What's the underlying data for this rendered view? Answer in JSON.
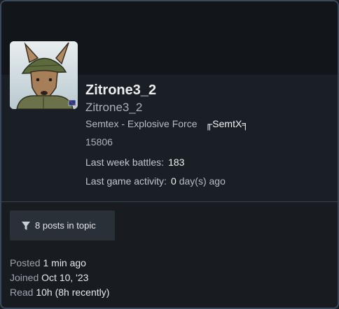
{
  "profile": {
    "username": "Zitrone3_2",
    "handle": "Zitrone3_2",
    "clan_name": "Semtex - Explosive Force",
    "clan_tag": "╓SemtX╕",
    "rating": "15806",
    "last_week_battles_label": "Last week battles:",
    "last_week_battles_value": "183",
    "last_activity_label": "Last game activity:",
    "last_activity_value": "0",
    "last_activity_unit": "day(s) ago"
  },
  "filter_button": {
    "label": "8 posts in topic",
    "icon": "funnel-icon"
  },
  "meta": {
    "posted_label": "Posted",
    "posted_value": "1 min ago",
    "joined_label": "Joined",
    "joined_value": "Oct 10, '23",
    "read_label": "Read",
    "read_value": "10h (8h recently)"
  },
  "colors": {
    "border": "#3a4a5c",
    "header_bg": "#12161b",
    "panel_bg": "#1a1f25",
    "button_bg": "#2a3038"
  }
}
